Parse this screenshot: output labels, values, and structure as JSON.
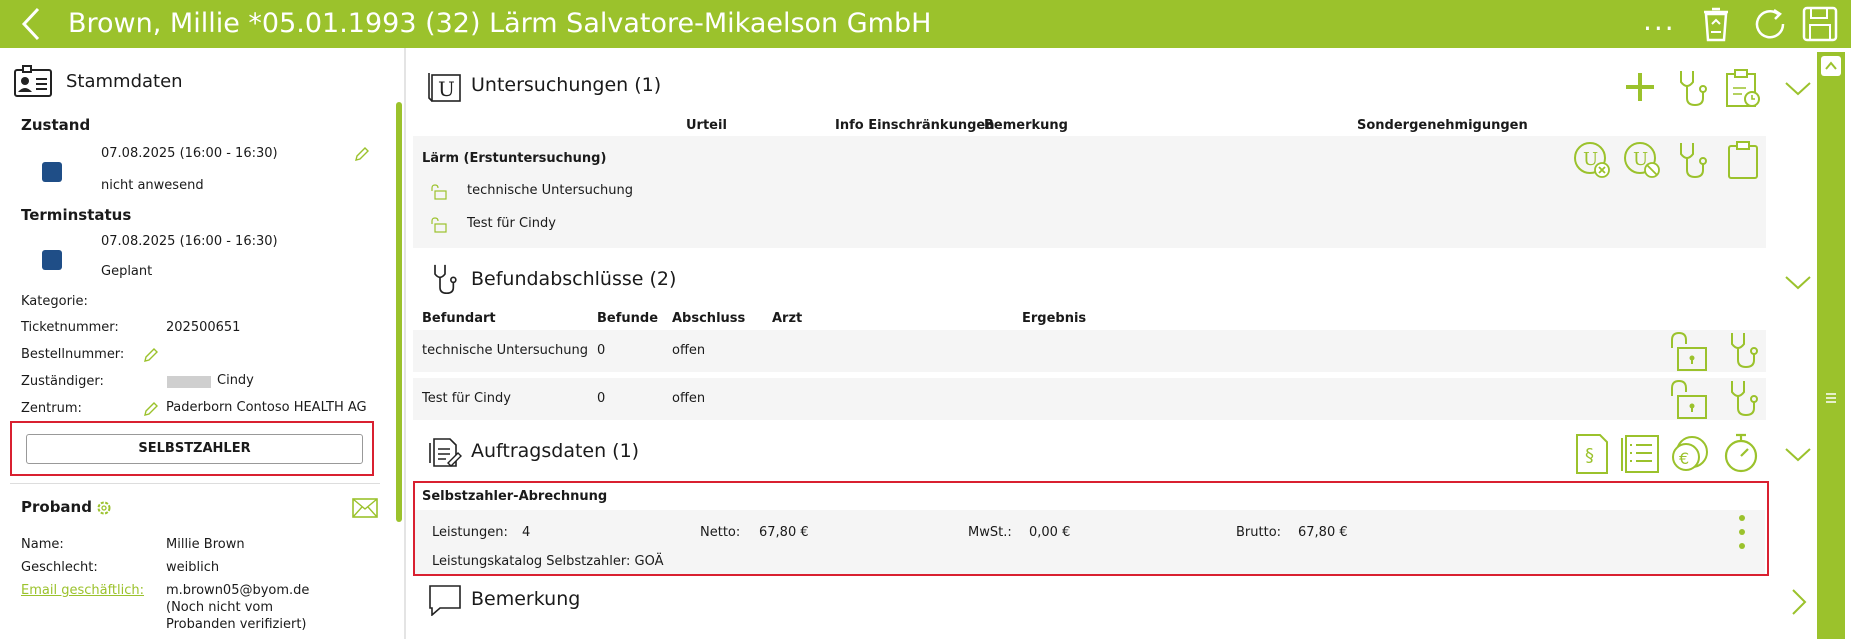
{
  "header": {
    "title": "Brown, Millie *05.01.1993 (32) Lärm Salvatore-Mikaelson GmbH",
    "more_label": "..."
  },
  "sidebar": {
    "title": "Stammdaten",
    "zustand": {
      "label": "Zustand",
      "time": "07.08.2025 (16:00 - 16:30)",
      "status": "nicht anwesend"
    },
    "terminstatus": {
      "label": "Terminstatus",
      "time": "07.08.2025 (16:00 - 16:30)",
      "status": "Geplant"
    },
    "fields": {
      "kategorie_label": "Kategorie:",
      "ticket_label": "Ticketnummer:",
      "ticket_value": "202500651",
      "bestell_label": "Bestellnummer:",
      "zust_label": "Zuständiger:",
      "zust_value": "Cindy",
      "zentrum_label": "Zentrum:",
      "zentrum_value": "Paderborn Contoso HEALTH AG"
    },
    "selbstzahler_button": "SELBSTZAHLER",
    "proband": {
      "title": "Proband",
      "name_label": "Name:",
      "name_value": "Millie Brown",
      "geschlecht_label": "Geschlecht:",
      "geschlecht_value": "weiblich",
      "email_label": "Email geschäftlich:",
      "email_value": "m.brown05@byom.de",
      "email_note1": "(Noch nicht vom",
      "email_note2": "Probanden verifiziert)"
    }
  },
  "untersuchungen": {
    "title": "Untersuchungen (1)",
    "columns": [
      "Urteil",
      "Info Einschränkungen",
      "Bemerkung",
      "Sondergenehmigungen"
    ],
    "group": "Lärm (Erstuntersuchung)",
    "items": [
      "technische Untersuchung",
      "Test für Cindy"
    ]
  },
  "befund": {
    "title": "Befundabschlüsse (2)",
    "columns": [
      "Befundart",
      "Befunde",
      "Abschluss",
      "Arzt",
      "Ergebnis"
    ],
    "rows": [
      {
        "art": "technische Untersuchung",
        "befunde": "0",
        "abschluss": "offen"
      },
      {
        "art": "Test für Cindy",
        "befunde": "0",
        "abschluss": "offen"
      }
    ]
  },
  "auftrag": {
    "title": "Auftragsdaten (1)",
    "subtitle": "Selbstzahler-Abrechnung",
    "leistungen_label": "Leistungen:",
    "leistungen_value": "4",
    "netto_label": "Netto:",
    "netto_value": "67,80 €",
    "mwst_label": "MwSt.:",
    "mwst_value": "0,00 €",
    "brutto_label": "Brutto:",
    "brutto_value": "67,80 €",
    "katalog": "Leistungskatalog Selbstzahler: GOÄ"
  },
  "bemerkung": {
    "title": "Bemerkung"
  },
  "colors": {
    "accent": "#9bc22c",
    "highlight": "#d92030",
    "status_square": "#1f4e87"
  }
}
